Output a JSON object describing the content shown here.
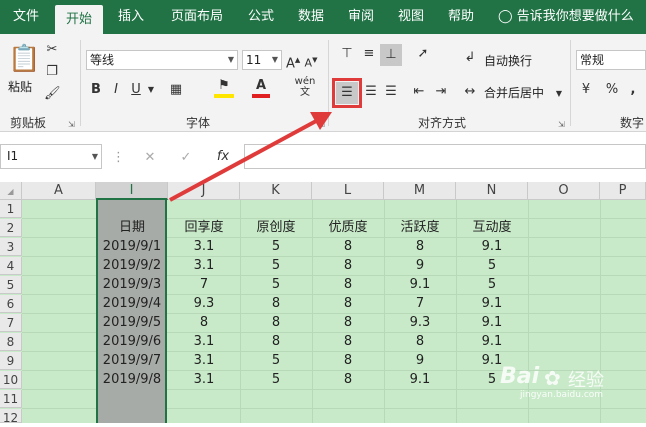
{
  "tabs": [
    "文件",
    "开始",
    "插入",
    "页面布局",
    "公式",
    "数据",
    "审阅",
    "视图",
    "帮助"
  ],
  "tell_me": "告诉我你想要做什么",
  "ribbon": {
    "paste_label": "粘贴",
    "clipboard_label": "剪贴板",
    "font_name": "等线",
    "font_size": "11",
    "font_label": "字体",
    "align_label": "对齐方式",
    "wrap_text": "自动换行",
    "merge_center": "合并后居中",
    "number_format": "常规",
    "number_label": "数字",
    "bold": "B",
    "italic": "I",
    "underline": "U",
    "percent": "%",
    "comma": ","
  },
  "formula_bar": {
    "name_box": "I1",
    "fx": "fx"
  },
  "sheet": {
    "columns": [
      "A",
      "I",
      "J",
      "K",
      "L",
      "M",
      "N",
      "O",
      "P"
    ],
    "rows": [
      "1",
      "2",
      "3",
      "4",
      "5",
      "6",
      "7",
      "8",
      "9",
      "10",
      "11",
      "12"
    ],
    "headers": [
      "日期",
      "回享度",
      "原创度",
      "优质度",
      "活跃度",
      "互动度"
    ],
    "data": [
      [
        "2019/9/1",
        "3.1",
        "5",
        "8",
        "8",
        "9.1"
      ],
      [
        "2019/9/2",
        "3.1",
        "5",
        "8",
        "9",
        "5"
      ],
      [
        "2019/9/3",
        "7",
        "5",
        "8",
        "9.1",
        "5"
      ],
      [
        "2019/9/4",
        "9.3",
        "8",
        "8",
        "7",
        "9.1"
      ],
      [
        "2019/9/5",
        "8",
        "8",
        "8",
        "9.3",
        "9.1"
      ],
      [
        "2019/9/6",
        "3.1",
        "8",
        "8",
        "8",
        "9.1"
      ],
      [
        "2019/9/7",
        "3.1",
        "5",
        "8",
        "9",
        "9.1"
      ],
      [
        "2019/9/8",
        "3.1",
        "5",
        "8",
        "9.1",
        "5"
      ]
    ]
  },
  "watermark": {
    "brand": "Bai",
    "brand_cn": "经验",
    "url": "jingyan.baidu.com"
  },
  "colors": {
    "excel_green": "#217346",
    "sheet_fill": "#c8eac9",
    "selected_col": "#a7aba7",
    "annotation_red": "#e03b3b"
  }
}
